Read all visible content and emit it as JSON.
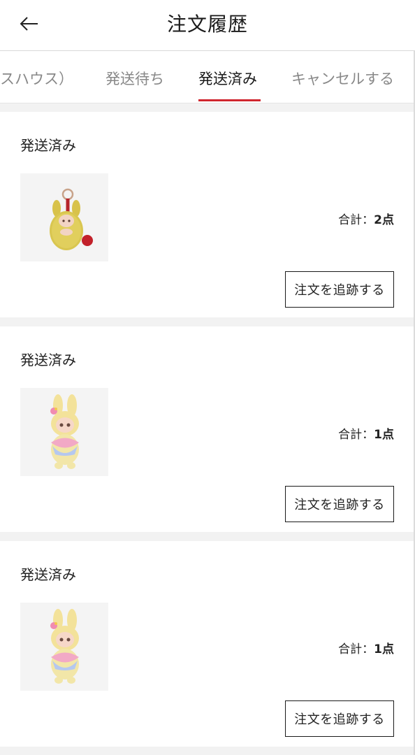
{
  "header": {
    "title": "注文履歴",
    "back_icon": "arrow-left-icon"
  },
  "tabs": [
    {
      "label": "スハウス）"
    },
    {
      "label": "発送待ち"
    },
    {
      "label": "発送済み",
      "active": true
    },
    {
      "label": "キャンセルする"
    }
  ],
  "colors": {
    "accent": "#d0262f",
    "background_gap": "#f2f2f2",
    "thumb_bg": "#f4f4f4"
  },
  "orders": [
    {
      "status": "発送済み",
      "product_icon": "fluffy-keychain-doll-icon",
      "total_label": "合計：",
      "total_count": "2点",
      "track_label": "注文を追跡する"
    },
    {
      "status": "発送済み",
      "product_icon": "bunny-bow-doll-icon",
      "total_label": "合計：",
      "total_count": "1点",
      "track_label": "注文を追跡する"
    },
    {
      "status": "発送済み",
      "product_icon": "bunny-bow-doll-icon",
      "total_label": "合計：",
      "total_count": "1点",
      "track_label": "注文を追跡する"
    }
  ]
}
